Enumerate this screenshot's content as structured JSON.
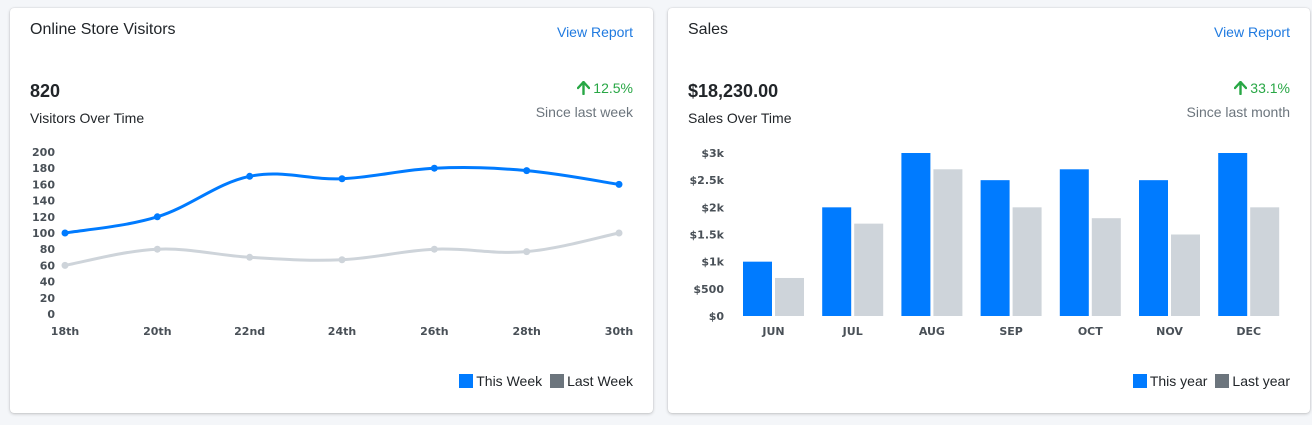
{
  "colors": {
    "primary": "#007bff",
    "secondary_line": "#ced4da",
    "legend_secondary": "#6c757d",
    "bar_secondary": "#ced4da",
    "positive": "#28a745",
    "link": "#1f7ae0"
  },
  "visitors": {
    "title": "Online Store Visitors",
    "link": "View Report",
    "value": "820",
    "value_label": "Visitors Over Time",
    "change": "12.5%",
    "change_icon": "arrow-up-icon",
    "since": "Since last week",
    "legend": [
      "This Week",
      "Last Week"
    ]
  },
  "sales": {
    "title": "Sales",
    "link": "View Report",
    "value": "$18,230.00",
    "value_label": "Sales Over Time",
    "change": "33.1%",
    "change_icon": "arrow-up-icon",
    "since": "Since last month",
    "legend": [
      "This year",
      "Last year"
    ]
  },
  "chart_data": [
    {
      "type": "line",
      "categories": [
        "18th",
        "20th",
        "22nd",
        "24th",
        "26th",
        "28th",
        "30th"
      ],
      "series": [
        {
          "name": "This Week",
          "values": [
            100,
            120,
            170,
            167,
            180,
            177,
            160
          ]
        },
        {
          "name": "Last Week",
          "values": [
            60,
            80,
            70,
            67,
            80,
            77,
            100
          ]
        }
      ],
      "yticks": [
        "0",
        "20",
        "40",
        "60",
        "80",
        "100",
        "120",
        "140",
        "160",
        "180",
        "200"
      ],
      "ylim": [
        0,
        200
      ],
      "grid": false,
      "legend_position": "bottom-right"
    },
    {
      "type": "bar",
      "categories": [
        "JUN",
        "JUL",
        "AUG",
        "SEP",
        "OCT",
        "NOV",
        "DEC"
      ],
      "series": [
        {
          "name": "This year",
          "values": [
            1000,
            2000,
            3000,
            2500,
            2700,
            2500,
            3000
          ]
        },
        {
          "name": "Last year",
          "values": [
            700,
            1700,
            2700,
            2000,
            1800,
            1500,
            2000
          ]
        }
      ],
      "yticks": [
        "$0",
        "$500",
        "$1k",
        "$1.5k",
        "$2k",
        "$2.5k",
        "$3k"
      ],
      "ylim": [
        0,
        3000
      ],
      "grid": false,
      "legend_position": "bottom-right"
    }
  ]
}
